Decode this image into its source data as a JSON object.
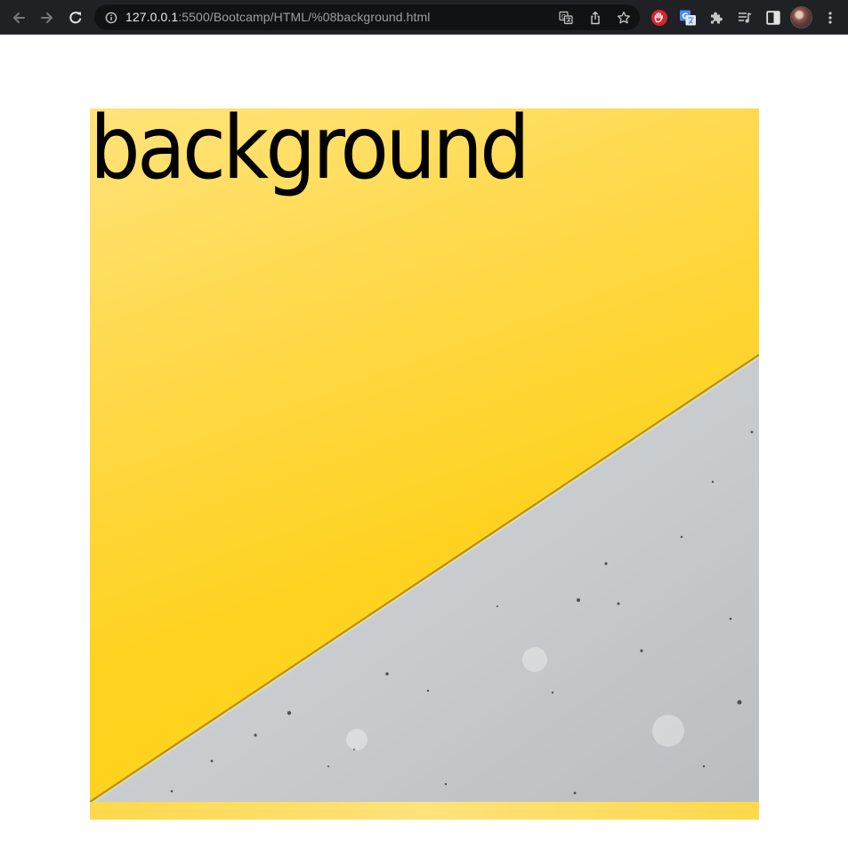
{
  "browser": {
    "url_host": "127.0.0.1",
    "url_rest": ":5500/Bootcamp/HTML/%08background.html",
    "icons": {
      "back": "arrow-left-icon",
      "forward": "arrow-right-icon",
      "reload": "reload-icon",
      "site_info": "info-icon",
      "translate": "translate-icon",
      "share": "share-icon",
      "bookmark": "star-icon",
      "extension_1": "hand-stop-icon",
      "extension_2": "google-translate-icon",
      "extensions": "puzzle-icon",
      "media": "media-queue-icon",
      "side_panel": "side-panel-icon",
      "profile": "avatar",
      "menu": "kebab-menu-icon"
    },
    "colors": {
      "toolbar": "#202124",
      "omnibox": "#111214",
      "icon": "#c4c7c5"
    }
  },
  "page": {
    "heading": "background",
    "colors": {
      "yellow": "#ffd21f",
      "concrete": "#c7cbcd",
      "text": "#000000"
    }
  }
}
